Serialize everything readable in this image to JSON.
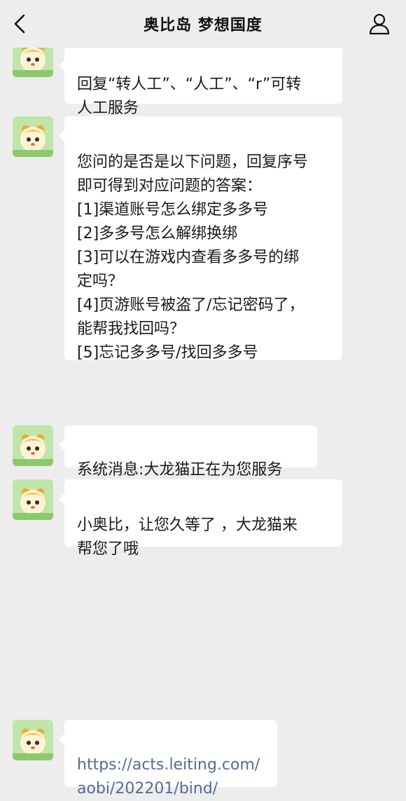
{
  "header": {
    "title": "奥比岛 梦想国度",
    "back_icon": "chevron-left-icon",
    "profile_icon": "person-icon"
  },
  "colors": {
    "background": "#ededed",
    "bubble": "#ffffff",
    "link": "#576b95"
  },
  "messages": [
    {
      "sender": "bot",
      "text": "回复“转人工”、“人工”、“r”可转\n人工服务"
    },
    {
      "sender": "bot",
      "text": "您问的是否是以下问题，回复序号\n即可得到对应问题的答案：\n[1]渠道账号怎么绑定多多号\n[2]多多号怎么解绑换绑\n[3]可以在游戏内查看多多号的绑\n定吗？\n[4]页游账号被盗了/忘记密码了，\n能帮我找回吗？\n[5]忘记多多号/找回多多号"
    },
    {
      "sender": "bot",
      "text": "系统消息:大龙猫正在为您服务"
    },
    {
      "sender": "bot",
      "text": "小奥比，让您久等了 ，大龙猫来\n帮您了哦"
    },
    {
      "sender": "bot",
      "link": "https://acts.leiting.com/\naobi/202201/bind/"
    }
  ]
}
